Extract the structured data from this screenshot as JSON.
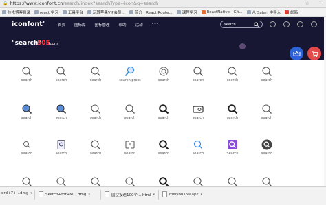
{
  "browser": {
    "url_host": "https://www.iconfont.cn",
    "url_path": "/search/index?searchType=icon&q=search",
    "bookmarks": [
      "技术博客目录",
      "react 学习",
      "工具平台",
      "玩转苹果VIP会员...",
      "简介 | React Route...",
      "课程学习",
      "ReactNative - Git...",
      "从 Safari 中导入",
      "邮箱"
    ]
  },
  "header": {
    "logo": "iconfont",
    "nav": [
      "首页",
      "图标库",
      "图标管理",
      "帮助",
      "活动",
      "•••"
    ],
    "search_value": "search"
  },
  "banner": {
    "query": "\"search\"",
    "count": "505",
    "unit": "icons"
  },
  "icons": [
    [
      "search",
      "search",
      "search",
      "search press",
      "search",
      "search",
      "search",
      "search"
    ],
    [
      "search",
      "search",
      "search",
      "search",
      "search",
      "search",
      "search",
      "search"
    ],
    [
      "search",
      "search",
      "search",
      "search",
      "search",
      "search",
      "Search",
      "search"
    ],
    [
      "",
      "",
      "",
      "",
      "",
      "",
      "",
      ""
    ]
  ],
  "downloads": [
    {
      "name": "ord+7+...dmg"
    },
    {
      "name": "Sketch+for+M....dmg"
    },
    {
      "name": "国空投送100个....html"
    },
    {
      "name": "meiyou169.apk"
    }
  ],
  "colors": {
    "header_bg": "#171734",
    "accent_red": "#ff3b3b",
    "fab_blue": "#2c64d8",
    "fab_red": "#e24949"
  }
}
